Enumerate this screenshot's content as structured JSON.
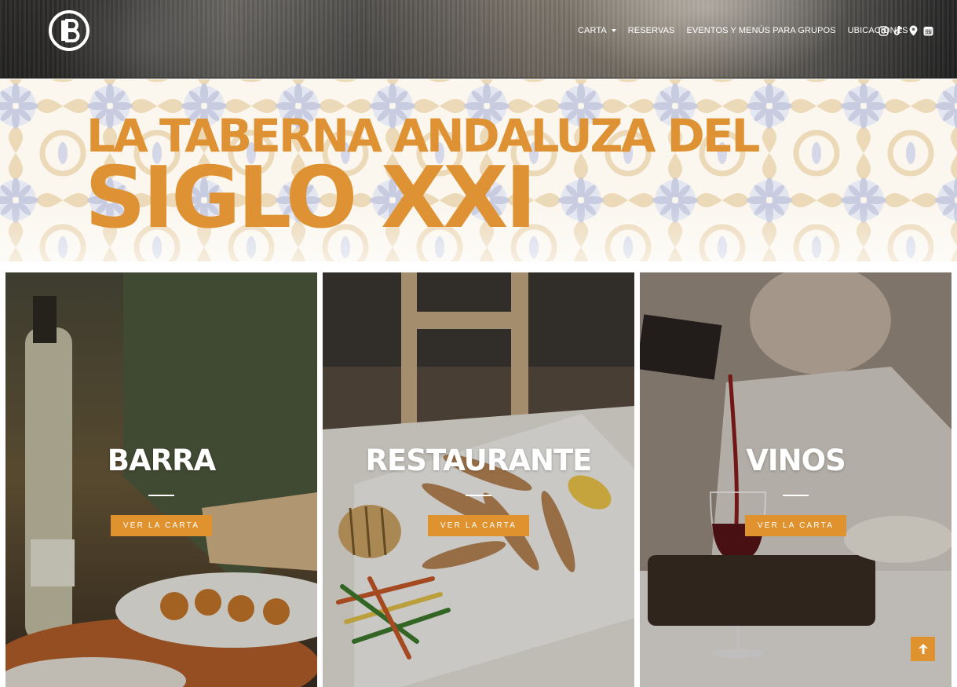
{
  "header": {
    "logo_letter": "B",
    "nav": [
      {
        "label": "CARTA",
        "has_dropdown": true
      },
      {
        "label": "RESERVAS"
      },
      {
        "label": "EVENTOS Y MENÚS PARA GRUPOS"
      },
      {
        "label": "UBICACIONES"
      }
    ],
    "social_icons": [
      "instagram-icon",
      "tiktok-icon",
      "map-pin-icon",
      "calendar-icon"
    ]
  },
  "hero": {
    "line1": "LA TABERNA ANDALUZA DEL",
    "line2": "SIGLO XXI"
  },
  "cards": [
    {
      "title": "BARRA",
      "button": "VER LA CARTA"
    },
    {
      "title": "RESTAURANTE",
      "button": "VER LA CARTA"
    },
    {
      "title": "VINOS",
      "button": "VER LA CARTA"
    }
  ],
  "colors": {
    "accent": "#e0922f",
    "hero_text": "#df9233",
    "tile_blue": "#c6cbe0",
    "tile_beige": "#ead7b5"
  }
}
